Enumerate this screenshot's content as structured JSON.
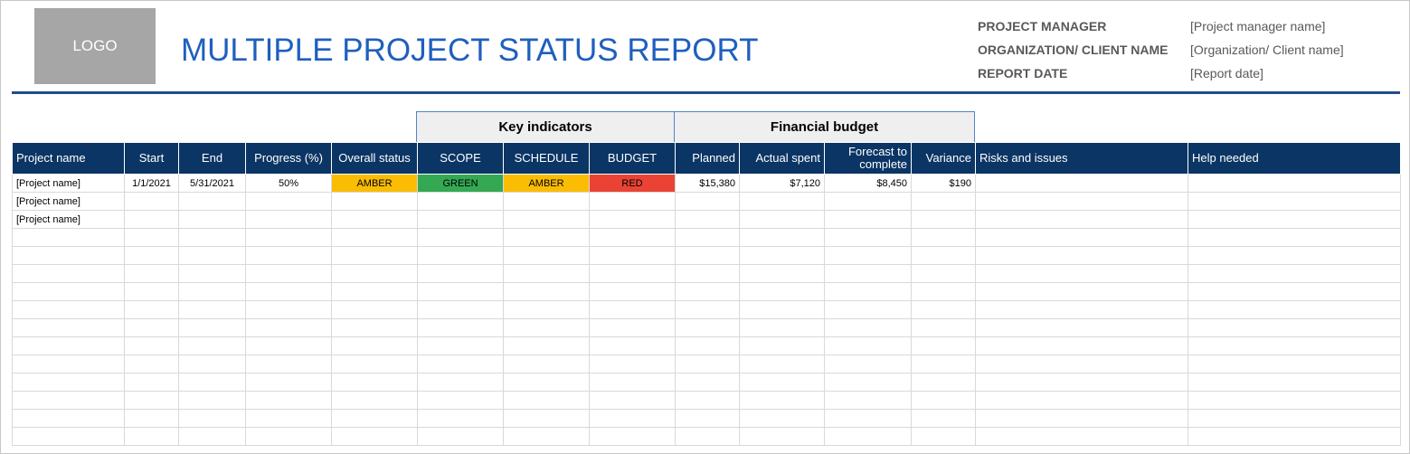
{
  "logo_text": "LOGO",
  "title": "MULTIPLE PROJECT STATUS REPORT",
  "meta": {
    "project_manager_label": "PROJECT MANAGER",
    "project_manager_value": "[Project manager name]",
    "organization_label": "ORGANIZATION/ CLIENT NAME",
    "organization_value": "[Organization/ Client name]",
    "report_date_label": "REPORT DATE",
    "report_date_value": "[Report date]"
  },
  "groups": {
    "key_indicators": "Key indicators",
    "financial_budget": "Financial budget"
  },
  "columns": [
    "Project name",
    "Start",
    "End",
    "Progress (%)",
    "Overall status",
    "SCOPE",
    "SCHEDULE",
    "BUDGET",
    "Planned",
    "Actual spent",
    "Forecast to complete",
    "Variance",
    "Risks and issues",
    "Help needed"
  ],
  "rows": [
    [
      "[Project name]",
      "1/1/2021",
      "5/31/2021",
      "50%",
      "AMBER",
      "GREEN",
      "AMBER",
      "RED",
      "$15,380",
      "$7,120",
      "$8,450",
      "$190",
      "",
      ""
    ],
    [
      "[Project name]",
      "",
      "",
      "",
      "",
      "",
      "",
      "",
      "",
      "",
      "",
      "",
      "",
      ""
    ],
    [
      "[Project name]",
      "",
      "",
      "",
      "",
      "",
      "",
      "",
      "",
      "",
      "",
      "",
      "",
      ""
    ],
    [
      "",
      "",
      "",
      "",
      "",
      "",
      "",
      "",
      "",
      "",
      "",
      "",
      "",
      ""
    ],
    [
      "",
      "",
      "",
      "",
      "",
      "",
      "",
      "",
      "",
      "",
      "",
      "",
      "",
      ""
    ],
    [
      "",
      "",
      "",
      "",
      "",
      "",
      "",
      "",
      "",
      "",
      "",
      "",
      "",
      ""
    ],
    [
      "",
      "",
      "",
      "",
      "",
      "",
      "",
      "",
      "",
      "",
      "",
      "",
      "",
      ""
    ],
    [
      "",
      "",
      "",
      "",
      "",
      "",
      "",
      "",
      "",
      "",
      "",
      "",
      "",
      ""
    ],
    [
      "",
      "",
      "",
      "",
      "",
      "",
      "",
      "",
      "",
      "",
      "",
      "",
      "",
      ""
    ],
    [
      "",
      "",
      "",
      "",
      "",
      "",
      "",
      "",
      "",
      "",
      "",
      "",
      "",
      ""
    ],
    [
      "",
      "",
      "",
      "",
      "",
      "",
      "",
      "",
      "",
      "",
      "",
      "",
      "",
      ""
    ],
    [
      "",
      "",
      "",
      "",
      "",
      "",
      "",
      "",
      "",
      "",
      "",
      "",
      "",
      ""
    ],
    [
      "",
      "",
      "",
      "",
      "",
      "",
      "",
      "",
      "",
      "",
      "",
      "",
      "",
      ""
    ],
    [
      "",
      "",
      "",
      "",
      "",
      "",
      "",
      "",
      "",
      "",
      "",
      "",
      "",
      ""
    ],
    [
      "",
      "",
      "",
      "",
      "",
      "",
      "",
      "",
      "",
      "",
      "",
      "",
      "",
      ""
    ]
  ],
  "status_colors": {
    "AMBER": "#fbbc04",
    "GREEN": "#34a853",
    "RED": "#ea4335"
  }
}
